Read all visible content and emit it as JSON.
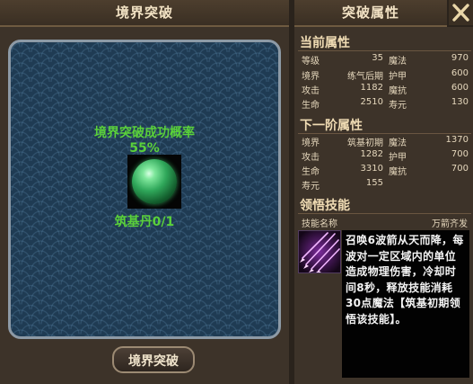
{
  "left_panel": {
    "title": "境界突破",
    "success_label": "境界突破成功概率",
    "success_rate": "55%",
    "item_count": "筑基丹0/1",
    "breakthrough_button": "境界突破"
  },
  "right_panel": {
    "title": "突破属性",
    "current": {
      "title": "当前属性",
      "rows": [
        {
          "l1": "等级",
          "v1": "35",
          "l2": "魔法",
          "v2": "970"
        },
        {
          "l1": "境界",
          "v1": "练气后期",
          "l2": "护甲",
          "v2": "600"
        },
        {
          "l1": "攻击",
          "v1": "1182",
          "l2": "魔抗",
          "v2": "600"
        },
        {
          "l1": "生命",
          "v1": "2510",
          "l2": "寿元",
          "v2": "130"
        }
      ]
    },
    "next": {
      "title": "下一阶属性",
      "rows": [
        {
          "l1": "境界",
          "v1": "筑基初期",
          "l2": "魔法",
          "v2": "1370"
        },
        {
          "l1": "攻击",
          "v1": "1282",
          "l2": "护甲",
          "v2": "700"
        },
        {
          "l1": "生命",
          "v1": "3310",
          "l2": "魔抗",
          "v2": "700"
        },
        {
          "l1": "寿元",
          "v1": "155",
          "l2": "",
          "v2": ""
        }
      ]
    },
    "skill": {
      "title": "领悟技能",
      "name_label": "技能名称",
      "name": "万箭齐发",
      "icon": "arrow-volley-icon",
      "description": "召唤6波箭从天而降，每波对一定区域内的单位造成物理伤害，冷却时间8秒，释放技能消耗30点魔法【筑基初期领悟该技能】。"
    }
  },
  "colors": {
    "accent_green": "#5ad13a",
    "panel_bg": "#3d3329",
    "header_text": "#f2e2c4"
  }
}
